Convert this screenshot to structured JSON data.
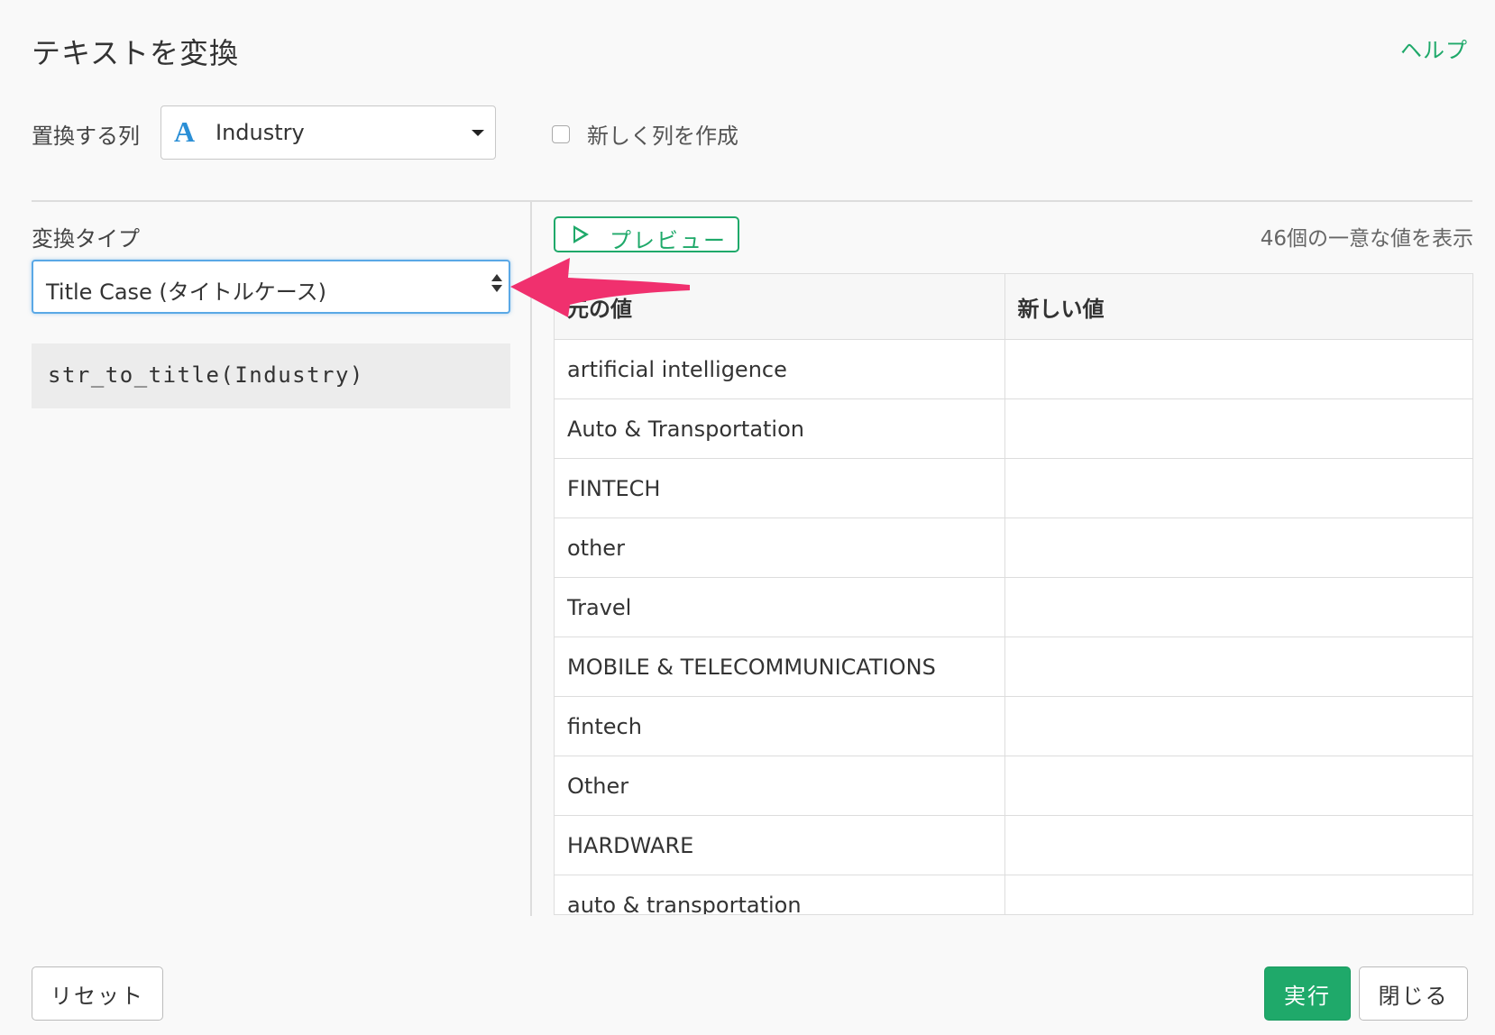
{
  "dialog": {
    "title": "テキストを変換",
    "help_label": "ヘルプ"
  },
  "column_selector": {
    "label": "置換する列",
    "type_icon": "A",
    "selected": "Industry"
  },
  "new_column": {
    "label": "新しく列を作成",
    "checked": false
  },
  "transform": {
    "label": "変換タイプ",
    "selected": "Title Case (タイトルケース)",
    "expression": "str_to_title(Industry)"
  },
  "preview": {
    "button_label": "プレビュー",
    "unique_count_text": "46個の一意な値を表示",
    "columns": [
      "元の値",
      "新しい値"
    ],
    "rows": [
      [
        "artificial intelligence",
        ""
      ],
      [
        "Auto & Transportation",
        ""
      ],
      [
        "FINTECH",
        ""
      ],
      [
        "other",
        ""
      ],
      [
        "Travel",
        ""
      ],
      [
        "MOBILE & TELECOMMUNICATIONS",
        ""
      ],
      [
        "fintech",
        ""
      ],
      [
        "Other",
        ""
      ],
      [
        "HARDWARE",
        ""
      ],
      [
        "auto & transportation",
        ""
      ]
    ]
  },
  "footer": {
    "reset_label": "リセット",
    "run_label": "実行",
    "close_label": "閉じる"
  },
  "colors": {
    "accent_green": "#1fa96a",
    "focus_blue": "#5aa8e6",
    "annotation_pink": "#f0306e"
  }
}
